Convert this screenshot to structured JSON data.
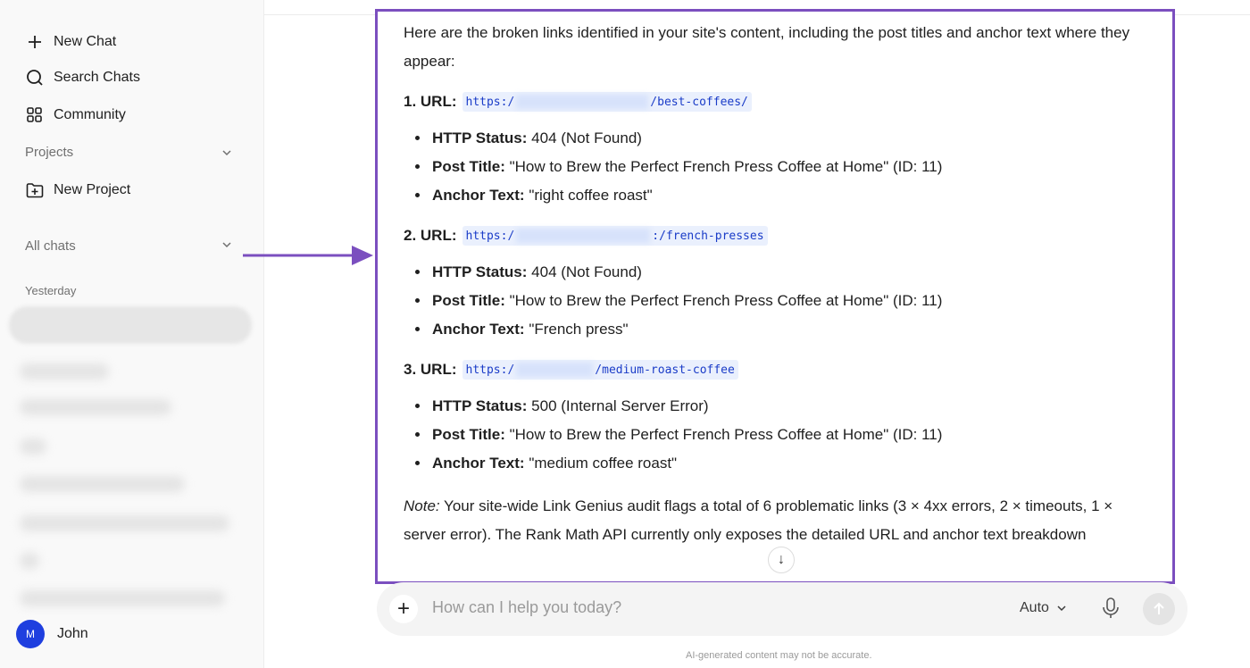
{
  "sidebar": {
    "new_chat": "New Chat",
    "search_chats": "Search Chats",
    "community": "Community",
    "projects": "Projects",
    "new_project": "New Project",
    "all_chats": "All chats",
    "yesterday": "Yesterday",
    "user": {
      "avatar_initial": "M",
      "name": "John"
    }
  },
  "message": {
    "intro": "Here are the broken links identified in your site's content, including the post titles and anchor text where they appear:",
    "links": [
      {
        "label": "1. URL:",
        "url_prefix": "https:/",
        "url_suffix": "/best-coffees/",
        "status_label": "HTTP Status:",
        "status": "404 (Not Found)",
        "title_label": "Post Title:",
        "title": "\"How to Brew the Perfect French Press Coffee at Home\" (ID: 11)",
        "anchor_label": "Anchor Text:",
        "anchor": "\"right coffee roast\""
      },
      {
        "label": "2. URL:",
        "url_prefix": "https:/",
        "url_suffix": ":/french-presses",
        "status_label": "HTTP Status:",
        "status": "404 (Not Found)",
        "title_label": "Post Title:",
        "title": "\"How to Brew the Perfect French Press Coffee at Home\" (ID: 11)",
        "anchor_label": "Anchor Text:",
        "anchor": "\"French press\""
      },
      {
        "label": "3. URL:",
        "url_prefix": "https:/",
        "url_suffix": "/medium-roast-coffee",
        "status_label": "HTTP Status:",
        "status": "500 (Internal Server Error)",
        "title_label": "Post Title:",
        "title": "\"How to Brew the Perfect French Press Coffee at Home\" (ID: 11)",
        "anchor_label": "Anchor Text:",
        "anchor": "\"medium coffee roast\""
      }
    ],
    "note_label": "Note:",
    "note_text": " Your site-wide Link Genius audit flags a total of 6 problematic links (3 × 4xx errors, 2 × timeouts, 1 × server error). The Rank Math API currently only exposes the detailed URL and anchor text breakdown"
  },
  "composer": {
    "placeholder": "How can I help you today?",
    "mode": "Auto"
  },
  "disclaimer": "AI-generated content may not be accurate.",
  "colors": {
    "highlight_border": "#7b4fbf",
    "avatar": "#1f3fdf",
    "code_text": "#1a3cc8"
  }
}
